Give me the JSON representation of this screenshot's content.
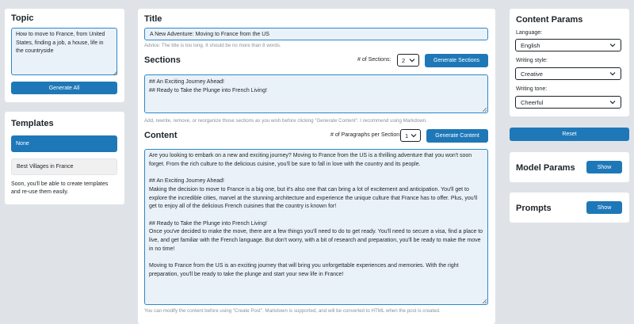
{
  "topic": {
    "heading": "Topic",
    "value": "How to move to France, from United States, finding a job, a house, life in the countryside",
    "generate_all_label": "Generate All"
  },
  "templates": {
    "heading": "Templates",
    "items": [
      {
        "label": "None",
        "selected": true
      },
      {
        "label": "Best Villages in France",
        "selected": false
      }
    ],
    "note": "Soon, you'll be able to create templates and re-use them easily."
  },
  "title_section": {
    "heading": "Title",
    "value": "A New Adventure: Moving to France from the US",
    "advice": "Advice: The title is too long. It should be no more than 8 words."
  },
  "sections": {
    "heading": "Sections",
    "count_label": "# of Sections:",
    "count_value": "2",
    "generate_label": "Generate Sections",
    "value": "## An Exciting Journey Ahead!\n## Ready to Take the Plunge into French Living!",
    "help": "Add, rewrite, remove, or reorganize those sections as you wish before clicking \"Generate Content\". I recommend using Markdown."
  },
  "content": {
    "heading": "Content",
    "count_label": "# of Paragraphs per Section:",
    "count_value": "1",
    "generate_label": "Generate Content",
    "value": "Are you looking to embark on a new and exciting journey? Moving to France from the US is a thrilling adventure that you won't soon forget. From the rich culture to the delicious cuisine, you'll be sure to fall in love with the country and its people.\n\n## An Exciting Journey Ahead!\nMaking the decision to move to France is a big one, but it's also one that can bring a lot of excitement and anticipation. You'll get to explore the incredible cities, marvel at the stunning architecture and experience the unique culture that France has to offer. Plus, you'll get to enjoy all of the delicious French cuisines that the country is known for!\n\n## Ready to Take the Plunge into French Living!\nOnce you've decided to make the move, there are a few things you'll need to do to get ready. You'll need to secure a visa, find a place to live, and get familiar with the French language. But don't worry, with a bit of research and preparation, you'll be ready to make the move in no time!\n\nMoving to France from the US is an exciting journey that will bring you unforgettable experiences and memories. With the right preparation, you'll be ready to take the plunge and start your new life in France!",
    "help": "You can modify the content before using \"Create Post\". Markdown is supported, and will be converted to HTML when the post is created."
  },
  "content_params": {
    "heading": "Content Params",
    "language_label": "Language:",
    "language_value": "English",
    "style_label": "Writing style:",
    "style_value": "Creative",
    "tone_label": "Writing tone:",
    "tone_value": "Cheerful"
  },
  "reset_label": "Reset",
  "model_params": {
    "heading": "Model Params",
    "show_label": "Show"
  },
  "prompts": {
    "heading": "Prompts",
    "show_label": "Show"
  },
  "colors": {
    "accent": "#1e78b8",
    "field_bg": "#eaf2f9",
    "field_border": "#2f87c7",
    "page_bg": "#dfe3e8"
  }
}
